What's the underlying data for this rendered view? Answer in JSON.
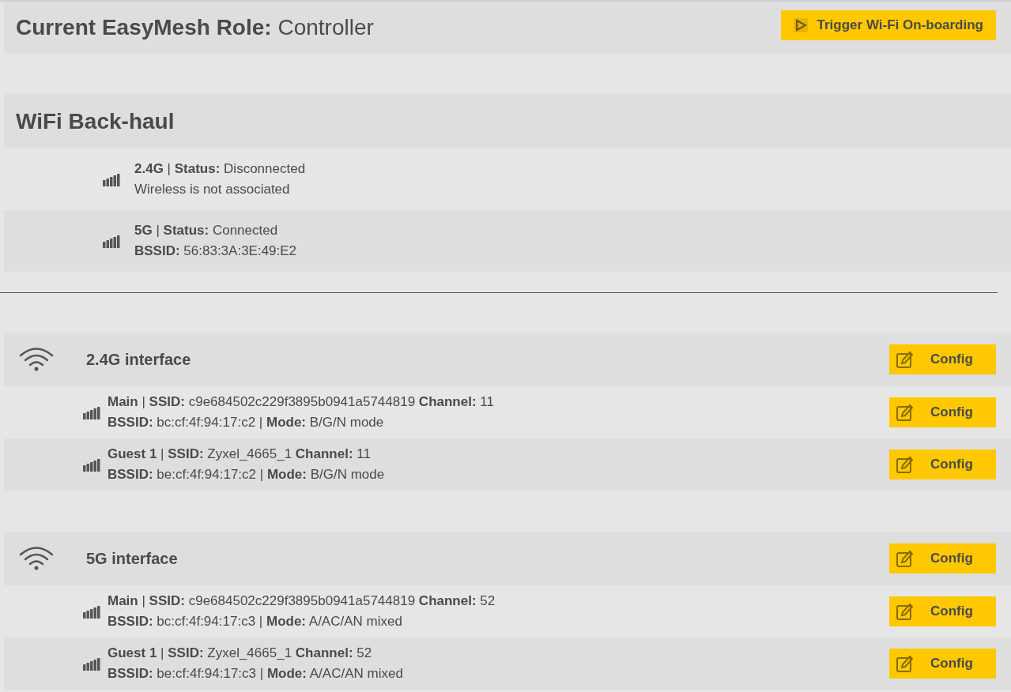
{
  "header": {
    "title": "**Current EasyMesh Role:** Controller",
    "button": "Trigger Wi-Fi On-boarding"
  },
  "backhaul": {
    "title": "WiFi Back-haul",
    "links": [
      {
        "line1": "**2.4G** | **Status:** Disconnected",
        "line2": "Wireless is not associated"
      },
      {
        "line1": "**5G** | **Status:** Connected",
        "line2": "**BSSID:** 56:83:3A:3E:49:E2"
      }
    ]
  },
  "interfaces": [
    {
      "title": "2.4G interface",
      "button": "Config",
      "ssids": [
        {
          "line1": "**Main** | **SSID:** c9e684502c229f3895b0941a5744819 **Channel:** 11",
          "line2": "**BSSID:** bc:cf:4f:94:17:c2 | **Mode:** B/G/N mode",
          "button": "Config"
        },
        {
          "line1": "**Guest 1** | **SSID:** Zyxel_4665_1 **Channel:** 11",
          "line2": "**BSSID:** be:cf:4f:94:17:c2 | **Mode:** B/G/N mode",
          "button": "Config"
        }
      ]
    },
    {
      "title": "5G interface",
      "button": "Config",
      "ssids": [
        {
          "line1": "**Main** | **SSID:** c9e684502c229f3895b0941a5744819 **Channel:** 52",
          "line2": "**BSSID:** bc:cf:4f:94:17:c3 | **Mode:** A/AC/AN mixed",
          "button": "Config"
        },
        {
          "line1": "**Guest 1** | **SSID:** Zyxel_4665_1 **Channel:** 52",
          "line2": "**BSSID:** be:cf:4f:94:17:c3 | **Mode:** A/AC/AN mixed",
          "button": "Config"
        }
      ]
    }
  ]
}
